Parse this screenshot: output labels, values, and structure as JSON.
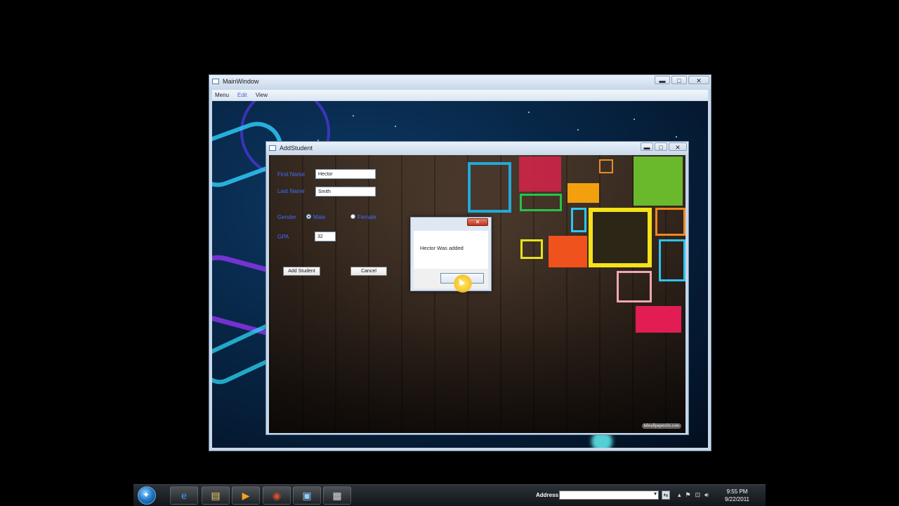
{
  "main_window": {
    "title": "MainWindow",
    "controls": {
      "minimize": "▬",
      "maximize": "□",
      "close": "✕"
    },
    "menu": [
      "Menu",
      "Edit",
      "View"
    ]
  },
  "add_window": {
    "title": "AddStudent",
    "controls": {
      "minimize": "▬",
      "maximize": "□",
      "close": "✕"
    },
    "first_name_label": "First Name",
    "first_name_value": "Hector",
    "last_name_label": "Last Name",
    "last_name_value": "Smith",
    "gender_label": "Gender",
    "male_label": "Male",
    "female_label": "Female",
    "gender_selected": "Male",
    "gpa_label": "GPA",
    "gpa_value": "32",
    "add_button": "Add Student",
    "cancel_button": "Cancel",
    "watermark": "hdwallpapersfix.com"
  },
  "message_box": {
    "close": "✕",
    "message": "Hector Was added",
    "ok_button": ""
  },
  "taskbar": {
    "apps": [
      "start-orb",
      "ie-icon",
      "explorer-icon",
      "media-player-icon",
      "chrome-icon",
      "window-app-icon",
      "app-icon"
    ],
    "address_label": "Address",
    "address_value": "",
    "time": "9:55 PM",
    "date": "9/22/2011"
  }
}
